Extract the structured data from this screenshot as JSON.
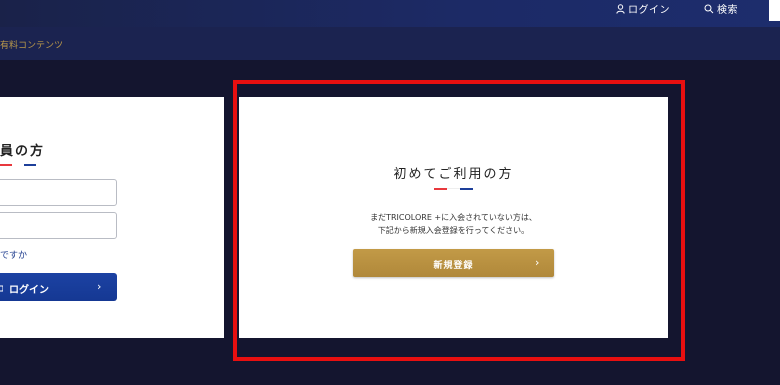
{
  "header": {
    "login_label": "ログイン",
    "search_label": "検索",
    "login_icon": "user-icon",
    "search_icon": "search-icon"
  },
  "subnav": {
    "label": "有料コンテンツ"
  },
  "member_card": {
    "heading": "員の方",
    "forgot_link": "ですか",
    "login_button": "ログイン",
    "login_icon": "lock-icon"
  },
  "first_time_card": {
    "heading": "初めてご利用の方",
    "description_line1": "まだTRICOLORE +に入会されていない方は、",
    "description_line2": "下記から新規入会登録を行ってください。",
    "register_button": "新規登録"
  },
  "colors": {
    "tricolor_red": "#e8383d",
    "tricolor_white": "#ffffff",
    "tricolor_blue": "#1d3f9a",
    "highlight": "#e80f10",
    "gold": "#b8903f"
  }
}
